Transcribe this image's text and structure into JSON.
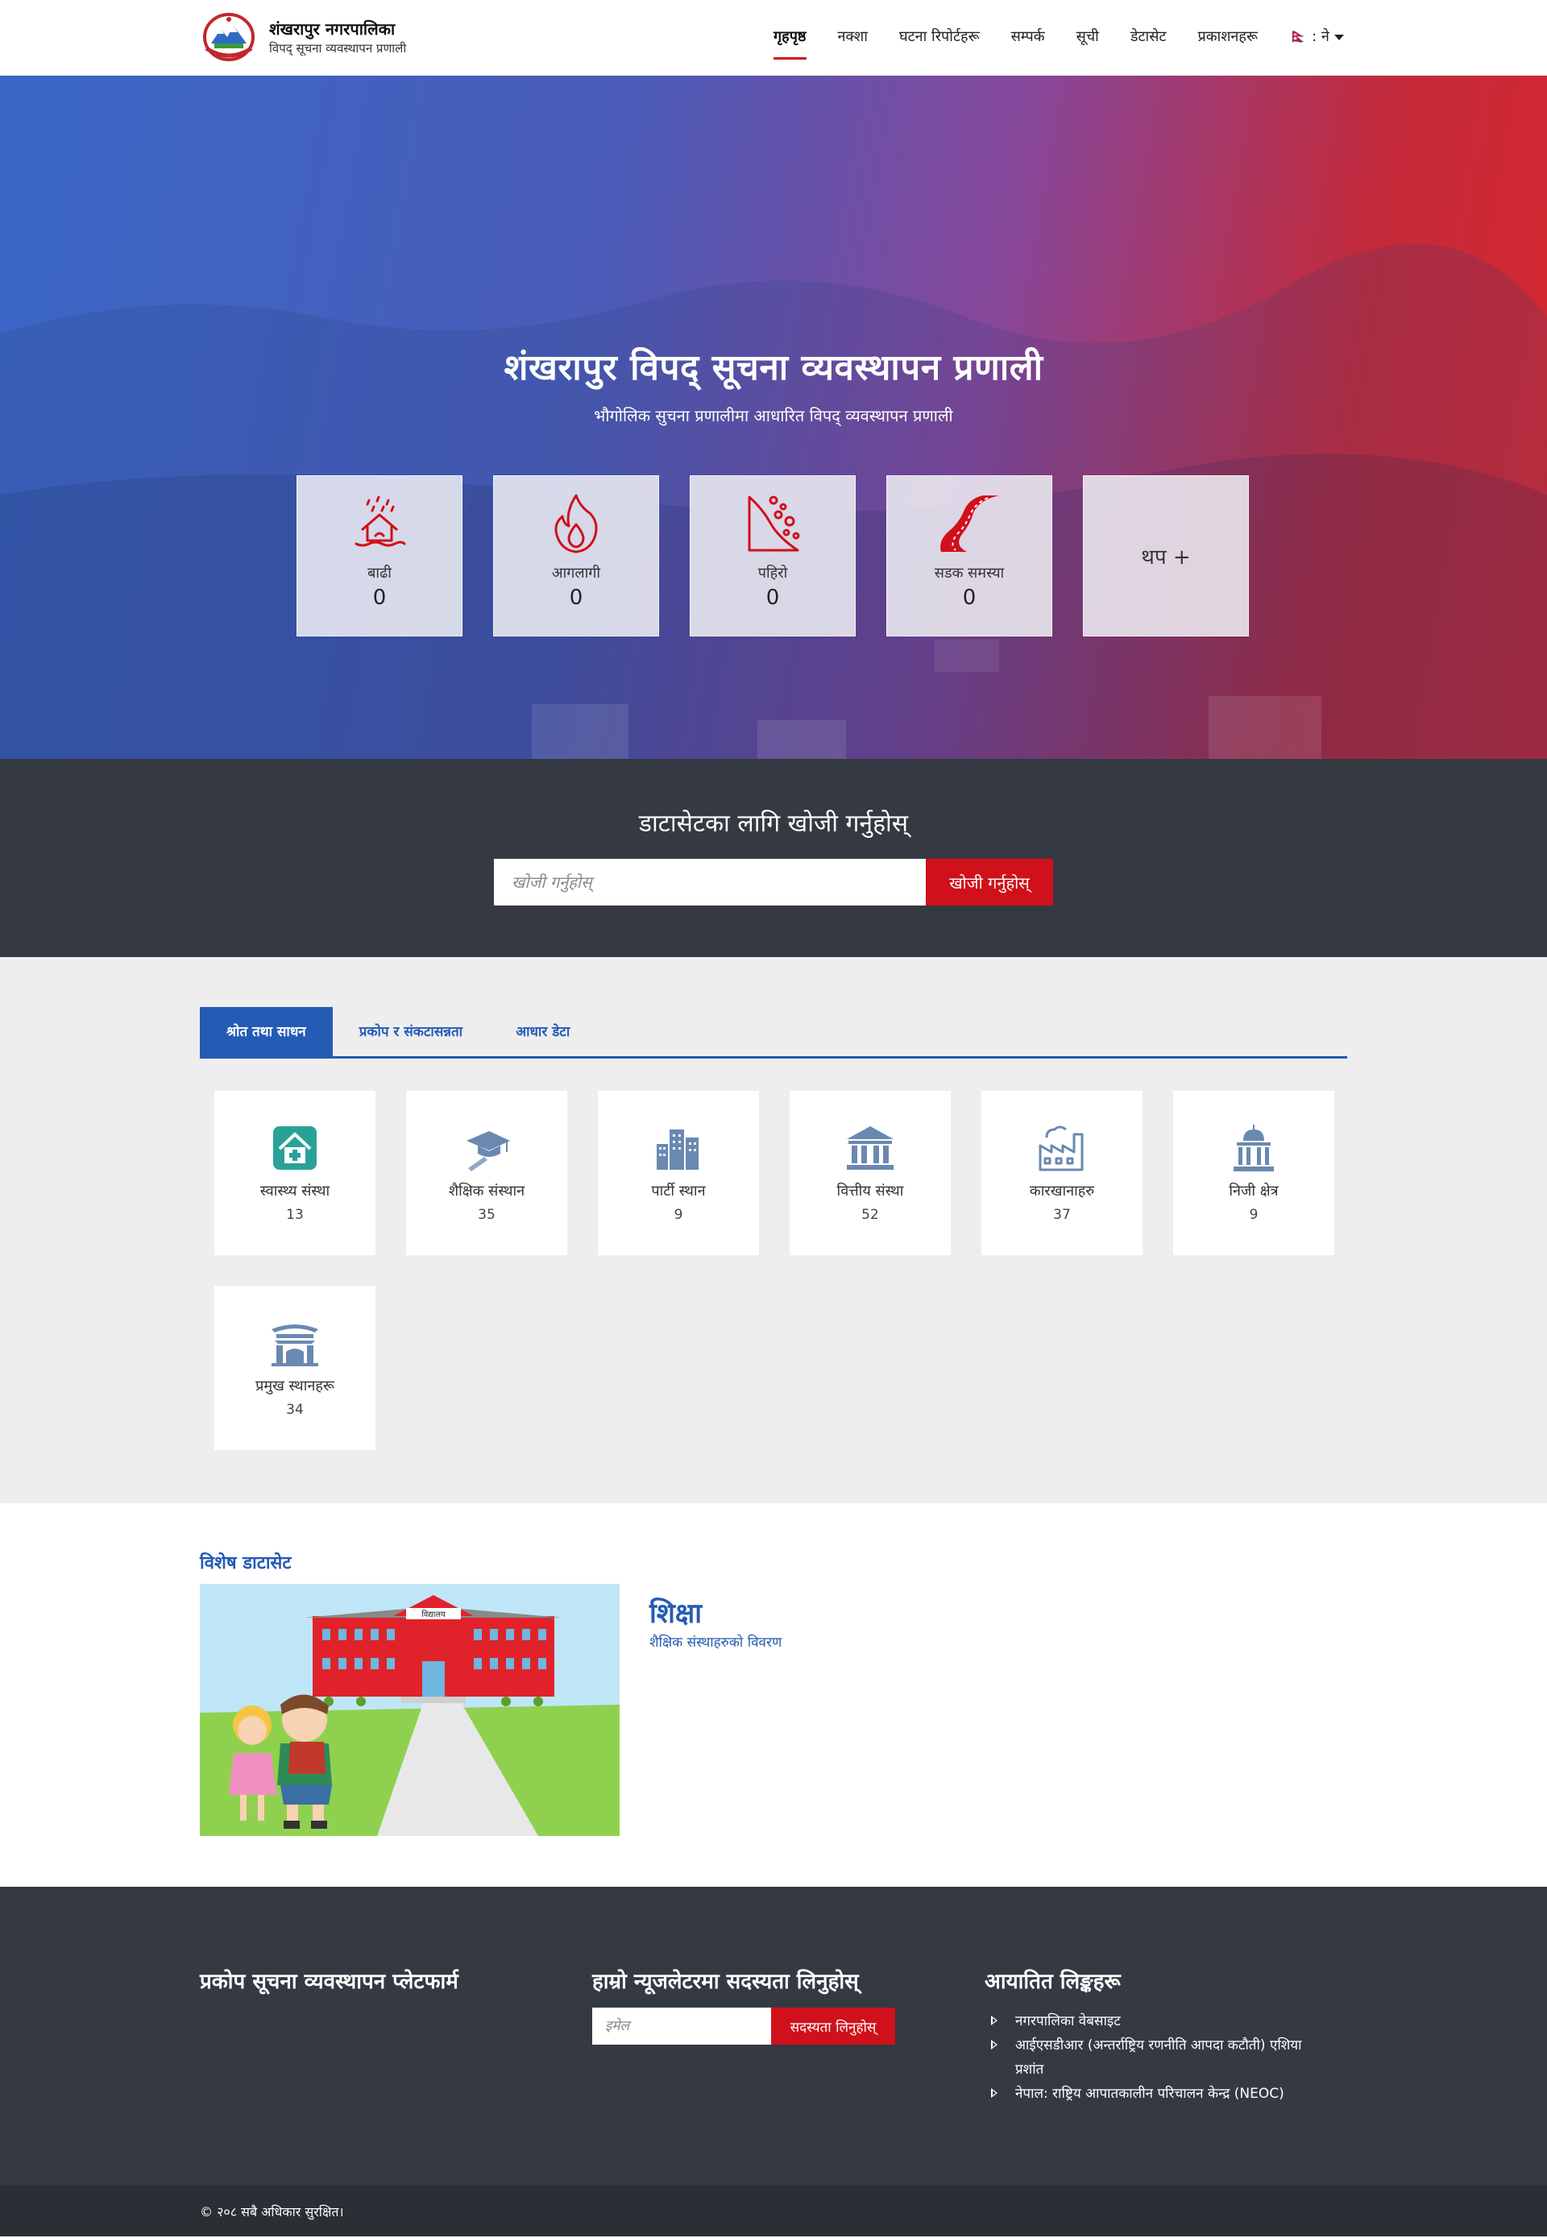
{
  "brand": {
    "title": "शंखरापुर नगरपालिका",
    "subtitle": "विपद् सूचना व्यवस्थापन प्रणाली"
  },
  "nav": {
    "items": [
      {
        "label": "गृहपृष्ठ",
        "active": true
      },
      {
        "label": "नक्शा"
      },
      {
        "label": "घटना रिपोर्टहरू"
      },
      {
        "label": "सम्पर्क"
      },
      {
        "label": "सूची"
      },
      {
        "label": "डेटासेट"
      },
      {
        "label": "प्रकाशनहरू"
      }
    ],
    "language": "🇳🇵 : ने"
  },
  "hero": {
    "title": "शंखरापुर विपद् सूचना व्यवस्थापन प्रणाली",
    "subtitle": "भौगोलिक सुचना प्रणालीमा आधारित विपद् व्यवस्थापन प्रणाली",
    "hazards": [
      {
        "label": "बाढी",
        "count": "0",
        "icon": "flood-icon"
      },
      {
        "label": "आगलागी",
        "count": "0",
        "icon": "fire-icon"
      },
      {
        "label": "पहिरो",
        "count": "0",
        "icon": "landslide-icon"
      },
      {
        "label": "सडक समस्या",
        "count": "0",
        "icon": "road-icon"
      }
    ],
    "more_label": "थप +"
  },
  "search": {
    "title": "डाटासेटका लागि खोजी गर्नुहोस्",
    "placeholder": "खोजी गर्नुहोस्",
    "button": "खोजी गर्नुहोस्"
  },
  "resources": {
    "tabs": [
      {
        "label": "श्रोत तथा साधन",
        "active": true
      },
      {
        "label": "प्रकोप र संकटासन्नता"
      },
      {
        "label": "आधार डेटा"
      }
    ],
    "items": [
      {
        "label": "स्वास्थ्य संस्था",
        "count": "13",
        "icon": "health-icon"
      },
      {
        "label": "शैक्षिक संस्थान",
        "count": "35",
        "icon": "education-icon"
      },
      {
        "label": "पार्टी स्थान",
        "count": "9",
        "icon": "building-icon"
      },
      {
        "label": "वित्तीय संस्था",
        "count": "52",
        "icon": "bank-icon"
      },
      {
        "label": "कारखानाहरु",
        "count": "37",
        "icon": "factory-icon"
      },
      {
        "label": "निजी क्षेत्र",
        "count": "9",
        "icon": "dome-building-icon"
      },
      {
        "label": "प्रमुख स्थानहरू",
        "count": "34",
        "icon": "gate-icon"
      }
    ]
  },
  "featured": {
    "heading": "विशेष डाटासेट",
    "title": "शिक्षा",
    "description": "शैक्षिक संस्थाहरुको विवरण",
    "image_sign": "विद्यालय"
  },
  "footer": {
    "col1_title": "प्रकोप सूचना व्यवस्थापन प्लेटफार्म",
    "col2_title": "हाम्रो न्यूजलेटरमा सदस्यता लिनुहोस्",
    "email_placeholder": "इमेल",
    "subscribe": "सदस्यता लिनुहोस्",
    "col3_title": "आयातित लिङ्कहरू",
    "links": [
      "नगरपालिका वेबसाइट",
      "आईएसडीआर (अन्तर्राष्ट्रिय रणनीति आपदा कटौती) एशिया प्रशांत",
      "नेपाल: राष्ट्रिय आपातकालीन परिचालन केन्द्र (NEOC)"
    ],
    "copyright": "© २०८   सबै अधिकार सुरक्षित।"
  },
  "colors": {
    "primary": "#245bb5",
    "accent": "#d0101b",
    "dark": "#353942"
  }
}
